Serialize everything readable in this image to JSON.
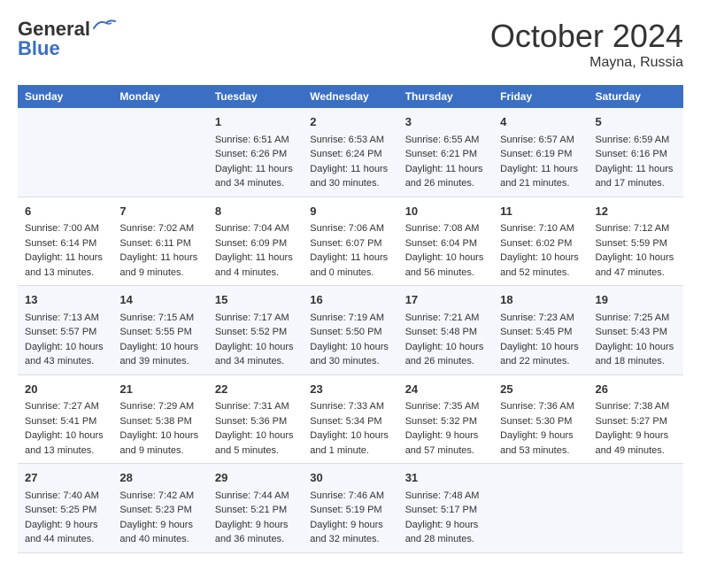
{
  "logo": {
    "general": "General",
    "blue": "Blue"
  },
  "title": "October 2024",
  "location": "Mayna, Russia",
  "days_of_week": [
    "Sunday",
    "Monday",
    "Tuesday",
    "Wednesday",
    "Thursday",
    "Friday",
    "Saturday"
  ],
  "weeks": [
    [
      {
        "day": "",
        "sunrise": "",
        "sunset": "",
        "daylight": ""
      },
      {
        "day": "",
        "sunrise": "",
        "sunset": "",
        "daylight": ""
      },
      {
        "day": "1",
        "sunrise": "Sunrise: 6:51 AM",
        "sunset": "Sunset: 6:26 PM",
        "daylight": "Daylight: 11 hours and 34 minutes."
      },
      {
        "day": "2",
        "sunrise": "Sunrise: 6:53 AM",
        "sunset": "Sunset: 6:24 PM",
        "daylight": "Daylight: 11 hours and 30 minutes."
      },
      {
        "day": "3",
        "sunrise": "Sunrise: 6:55 AM",
        "sunset": "Sunset: 6:21 PM",
        "daylight": "Daylight: 11 hours and 26 minutes."
      },
      {
        "day": "4",
        "sunrise": "Sunrise: 6:57 AM",
        "sunset": "Sunset: 6:19 PM",
        "daylight": "Daylight: 11 hours and 21 minutes."
      },
      {
        "day": "5",
        "sunrise": "Sunrise: 6:59 AM",
        "sunset": "Sunset: 6:16 PM",
        "daylight": "Daylight: 11 hours and 17 minutes."
      }
    ],
    [
      {
        "day": "6",
        "sunrise": "Sunrise: 7:00 AM",
        "sunset": "Sunset: 6:14 PM",
        "daylight": "Daylight: 11 hours and 13 minutes."
      },
      {
        "day": "7",
        "sunrise": "Sunrise: 7:02 AM",
        "sunset": "Sunset: 6:11 PM",
        "daylight": "Daylight: 11 hours and 9 minutes."
      },
      {
        "day": "8",
        "sunrise": "Sunrise: 7:04 AM",
        "sunset": "Sunset: 6:09 PM",
        "daylight": "Daylight: 11 hours and 4 minutes."
      },
      {
        "day": "9",
        "sunrise": "Sunrise: 7:06 AM",
        "sunset": "Sunset: 6:07 PM",
        "daylight": "Daylight: 11 hours and 0 minutes."
      },
      {
        "day": "10",
        "sunrise": "Sunrise: 7:08 AM",
        "sunset": "Sunset: 6:04 PM",
        "daylight": "Daylight: 10 hours and 56 minutes."
      },
      {
        "day": "11",
        "sunrise": "Sunrise: 7:10 AM",
        "sunset": "Sunset: 6:02 PM",
        "daylight": "Daylight: 10 hours and 52 minutes."
      },
      {
        "day": "12",
        "sunrise": "Sunrise: 7:12 AM",
        "sunset": "Sunset: 5:59 PM",
        "daylight": "Daylight: 10 hours and 47 minutes."
      }
    ],
    [
      {
        "day": "13",
        "sunrise": "Sunrise: 7:13 AM",
        "sunset": "Sunset: 5:57 PM",
        "daylight": "Daylight: 10 hours and 43 minutes."
      },
      {
        "day": "14",
        "sunrise": "Sunrise: 7:15 AM",
        "sunset": "Sunset: 5:55 PM",
        "daylight": "Daylight: 10 hours and 39 minutes."
      },
      {
        "day": "15",
        "sunrise": "Sunrise: 7:17 AM",
        "sunset": "Sunset: 5:52 PM",
        "daylight": "Daylight: 10 hours and 34 minutes."
      },
      {
        "day": "16",
        "sunrise": "Sunrise: 7:19 AM",
        "sunset": "Sunset: 5:50 PM",
        "daylight": "Daylight: 10 hours and 30 minutes."
      },
      {
        "day": "17",
        "sunrise": "Sunrise: 7:21 AM",
        "sunset": "Sunset: 5:48 PM",
        "daylight": "Daylight: 10 hours and 26 minutes."
      },
      {
        "day": "18",
        "sunrise": "Sunrise: 7:23 AM",
        "sunset": "Sunset: 5:45 PM",
        "daylight": "Daylight: 10 hours and 22 minutes."
      },
      {
        "day": "19",
        "sunrise": "Sunrise: 7:25 AM",
        "sunset": "Sunset: 5:43 PM",
        "daylight": "Daylight: 10 hours and 18 minutes."
      }
    ],
    [
      {
        "day": "20",
        "sunrise": "Sunrise: 7:27 AM",
        "sunset": "Sunset: 5:41 PM",
        "daylight": "Daylight: 10 hours and 13 minutes."
      },
      {
        "day": "21",
        "sunrise": "Sunrise: 7:29 AM",
        "sunset": "Sunset: 5:38 PM",
        "daylight": "Daylight: 10 hours and 9 minutes."
      },
      {
        "day": "22",
        "sunrise": "Sunrise: 7:31 AM",
        "sunset": "Sunset: 5:36 PM",
        "daylight": "Daylight: 10 hours and 5 minutes."
      },
      {
        "day": "23",
        "sunrise": "Sunrise: 7:33 AM",
        "sunset": "Sunset: 5:34 PM",
        "daylight": "Daylight: 10 hours and 1 minute."
      },
      {
        "day": "24",
        "sunrise": "Sunrise: 7:35 AM",
        "sunset": "Sunset: 5:32 PM",
        "daylight": "Daylight: 9 hours and 57 minutes."
      },
      {
        "day": "25",
        "sunrise": "Sunrise: 7:36 AM",
        "sunset": "Sunset: 5:30 PM",
        "daylight": "Daylight: 9 hours and 53 minutes."
      },
      {
        "day": "26",
        "sunrise": "Sunrise: 7:38 AM",
        "sunset": "Sunset: 5:27 PM",
        "daylight": "Daylight: 9 hours and 49 minutes."
      }
    ],
    [
      {
        "day": "27",
        "sunrise": "Sunrise: 7:40 AM",
        "sunset": "Sunset: 5:25 PM",
        "daylight": "Daylight: 9 hours and 44 minutes."
      },
      {
        "day": "28",
        "sunrise": "Sunrise: 7:42 AM",
        "sunset": "Sunset: 5:23 PM",
        "daylight": "Daylight: 9 hours and 40 minutes."
      },
      {
        "day": "29",
        "sunrise": "Sunrise: 7:44 AM",
        "sunset": "Sunset: 5:21 PM",
        "daylight": "Daylight: 9 hours and 36 minutes."
      },
      {
        "day": "30",
        "sunrise": "Sunrise: 7:46 AM",
        "sunset": "Sunset: 5:19 PM",
        "daylight": "Daylight: 9 hours and 32 minutes."
      },
      {
        "day": "31",
        "sunrise": "Sunrise: 7:48 AM",
        "sunset": "Sunset: 5:17 PM",
        "daylight": "Daylight: 9 hours and 28 minutes."
      },
      {
        "day": "",
        "sunrise": "",
        "sunset": "",
        "daylight": ""
      },
      {
        "day": "",
        "sunrise": "",
        "sunset": "",
        "daylight": ""
      }
    ]
  ]
}
